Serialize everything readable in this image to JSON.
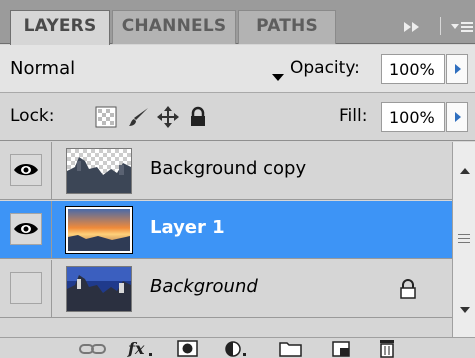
{
  "tabs": [
    {
      "label": "LAYERS",
      "active": true
    },
    {
      "label": "CHANNELS",
      "active": false
    },
    {
      "label": "PATHS",
      "active": false
    }
  ],
  "tab_controls": {
    "collapse_glyph": "▸▸",
    "menu_glyph": "▾≡"
  },
  "blend": {
    "mode": "Normal",
    "opacity_label": "Opacity:",
    "opacity_value": "100%"
  },
  "lock": {
    "label": "Lock:",
    "fill_label": "Fill:",
    "fill_value": "100%",
    "icons": [
      "lock-transparent-icon",
      "lock-image-brush-icon",
      "lock-position-move-icon",
      "lock-all-padlock-icon"
    ]
  },
  "layers": [
    {
      "name": "Background copy",
      "visible": true,
      "selected": false,
      "locked": false
    },
    {
      "name": "Layer 1",
      "visible": true,
      "selected": true,
      "locked": false
    },
    {
      "name": "Background",
      "visible": false,
      "selected": false,
      "locked": true
    }
  ],
  "footer_icons": [
    "link-layers-icon",
    "fx-layer-style-icon",
    "layer-mask-icon",
    "adjustment-layer-icon",
    "new-group-folder-icon",
    "new-layer-icon",
    "trash-icon"
  ],
  "colors": {
    "selection": "#3d94f6",
    "panel": "#d6d6d6",
    "tabbar": "#9b9b9b",
    "spin_arrow": "#2f6fbf"
  }
}
